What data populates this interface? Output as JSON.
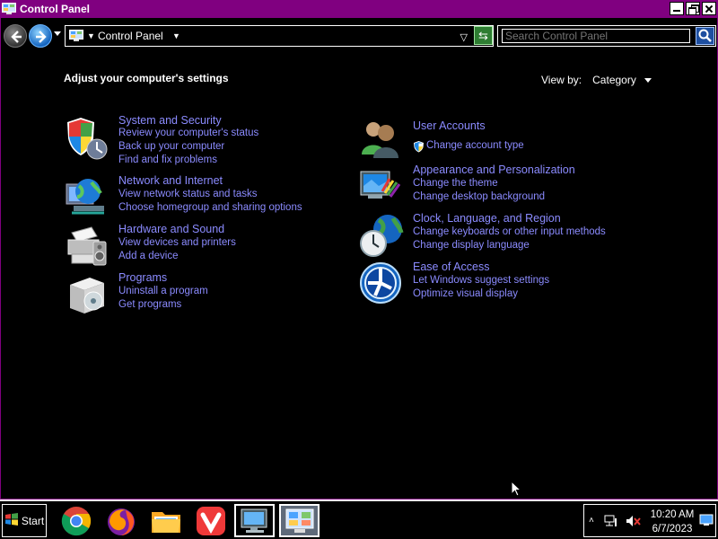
{
  "window": {
    "title": "Control Panel",
    "accent": "#800080"
  },
  "addressbar": {
    "location": "Control Panel",
    "search_placeholder": "Search Control Panel"
  },
  "main": {
    "heading": "Adjust your computer's settings",
    "view_by_label": "View by:",
    "view_by_value": "Category",
    "link_color": "#8b8bff"
  },
  "categories": {
    "system": {
      "title": "System and Security",
      "links": [
        "Review your computer's status",
        "Back up your computer",
        "Find and fix problems"
      ],
      "icon": "shield-icon"
    },
    "network": {
      "title": "Network and Internet",
      "links": [
        "View network status and tasks",
        "Choose homegroup and sharing options"
      ],
      "icon": "network-globe-icon"
    },
    "hardware": {
      "title": "Hardware and Sound",
      "links": [
        "View devices and printers",
        "Add a device"
      ],
      "icon": "printer-icon"
    },
    "programs": {
      "title": "Programs",
      "links": [
        "Uninstall a program",
        "Get programs"
      ],
      "icon": "programs-box-icon"
    },
    "users": {
      "title": "User Accounts",
      "links": [
        "Change account type"
      ],
      "icon": "users-icon"
    },
    "appearance": {
      "title": "Appearance and Personalization",
      "links": [
        "Change the theme",
        "Change desktop background"
      ],
      "icon": "monitor-palette-icon"
    },
    "clock": {
      "title": "Clock, Language, and Region",
      "links": [
        "Change keyboards or other input methods",
        "Change display language"
      ],
      "icon": "clock-globe-icon"
    },
    "ease": {
      "title": "Ease of Access",
      "links": [
        "Let Windows suggest settings",
        "Optimize visual display"
      ],
      "icon": "ease-of-access-icon"
    }
  },
  "taskbar": {
    "start_label": "Start",
    "apps": [
      "chrome-icon",
      "firefox-icon",
      "file-explorer-icon",
      "vivaldi-icon",
      "remote-desktop-icon",
      "control-panel-icon"
    ],
    "time": "10:20 AM",
    "date": "6/7/2023"
  }
}
